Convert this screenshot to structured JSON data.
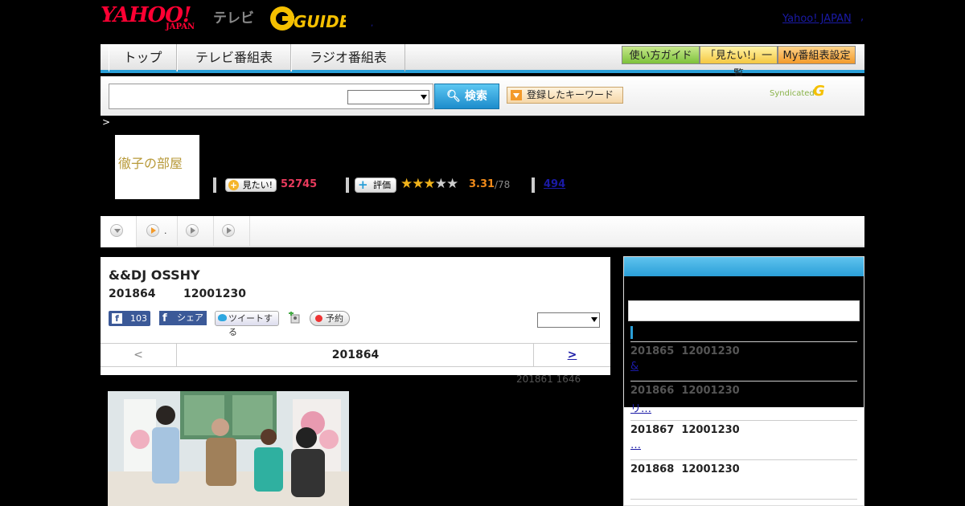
{
  "header": {
    "logo_yahoo": "YAHOO!",
    "logo_japan": "JAPAN",
    "logo_tv": "テレビ",
    "logo_gguide": "GUIDE",
    "yahoo_japan_link": "Yahoo! JAPAN"
  },
  "nav": {
    "tabs": [
      {
        "label": "トップ"
      },
      {
        "label": "テレビ番組表"
      },
      {
        "label": "ラジオ番組表"
      }
    ],
    "buttons": [
      {
        "label": "使い方ガイド"
      },
      {
        "label": "「見たい!」一覧"
      },
      {
        "label": "My番組表設定"
      }
    ]
  },
  "search": {
    "input_value": "",
    "select_value": "",
    "button_label": "検索",
    "keyword_button_label": "登録したキーワード",
    "syndicated_label": "Syndicated"
  },
  "breadcrumb": ">",
  "program": {
    "thumbnail_text": "徹子の部屋",
    "mitai_label": "見たい!",
    "mitai_count": "52745",
    "hyoka_label": "評価",
    "rating": "3.31",
    "rating_count": "/78",
    "rating_value": 3.31,
    "review_count": "494"
  },
  "detail": {
    "title": "&&DJ OSSHY",
    "date": "201864",
    "time": "12001230",
    "facebook_count": "103",
    "share_label": "シェア",
    "tweet_label": "ツイートする",
    "reserve_label": "予約",
    "select_value": "",
    "prev_label": "<",
    "current_date": "201864",
    "next_label": ">",
    "updated": "201861  1646"
  },
  "tabstrip": {
    "second_tab_dot": "."
  },
  "sidebar": {
    "items": [
      {
        "date": "201865",
        "time": "12001230",
        "link": "&"
      },
      {
        "date": "201866",
        "time": "12001230",
        "link": "リ…"
      },
      {
        "date": "201867",
        "time": "12001230",
        "link": "…"
      },
      {
        "date": "201868",
        "time": "12001230",
        "link": ""
      }
    ]
  },
  "colors": {
    "accent_blue": "#2a9fd8",
    "brand_red": "#ff0033",
    "mitai_pink": "#e83a5c",
    "rating_orange": "#f08a1a"
  }
}
